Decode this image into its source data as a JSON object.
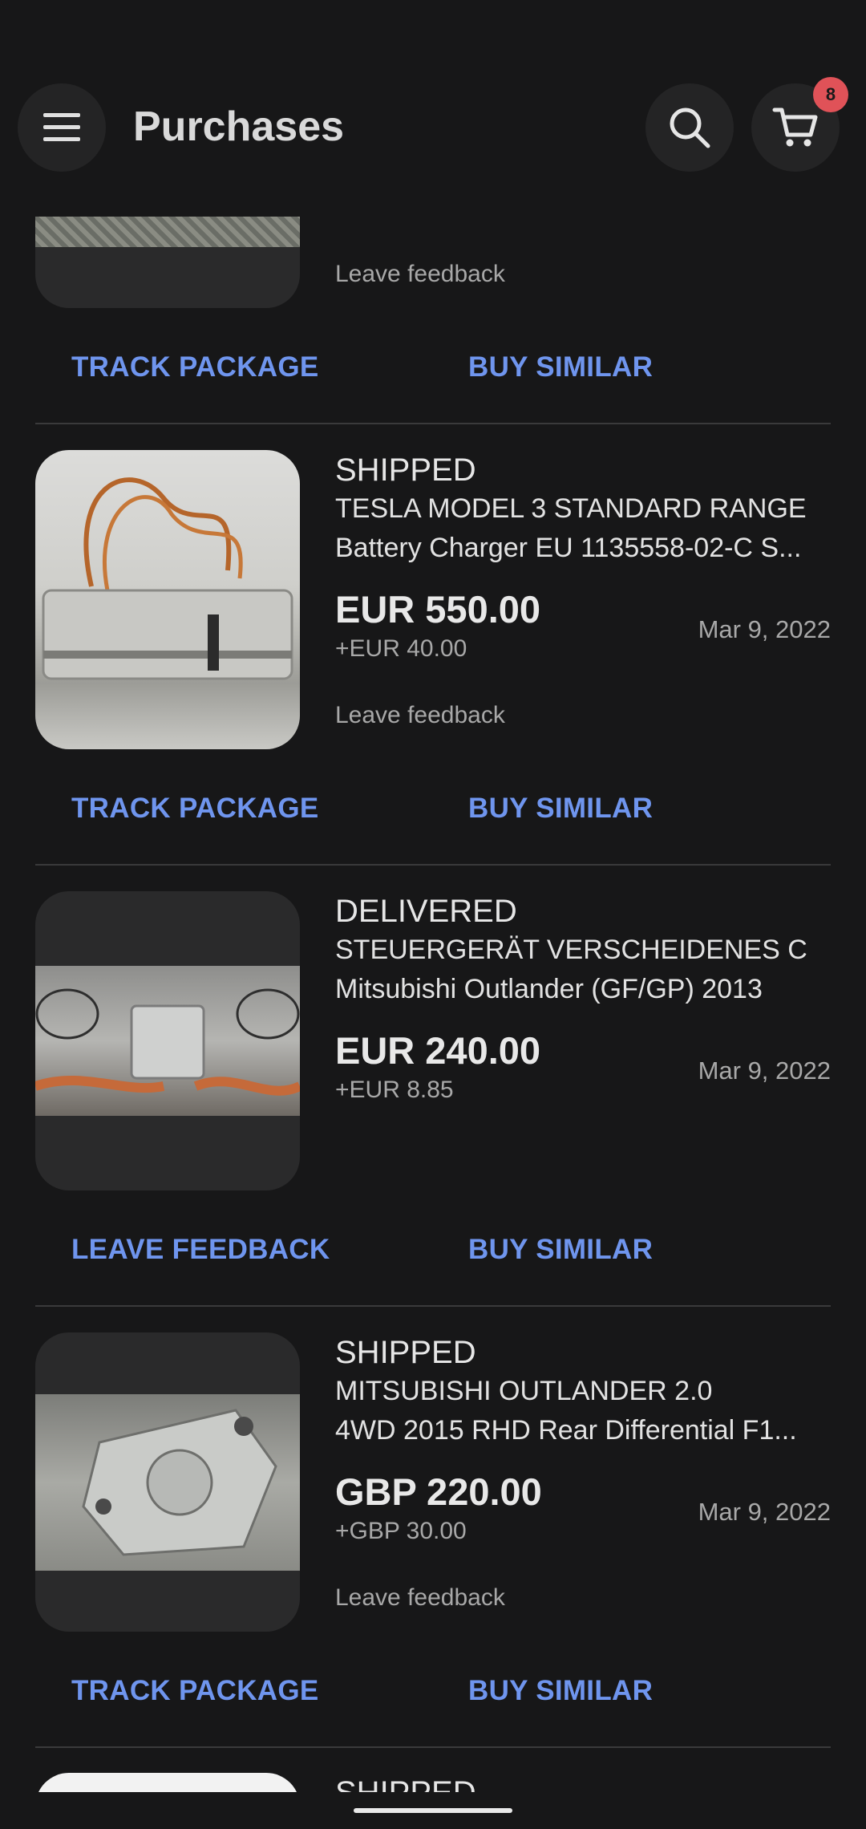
{
  "header": {
    "title": "Purchases",
    "cart_count": "8",
    "icons": [
      "menu-icon",
      "search-icon",
      "cart-icon"
    ]
  },
  "colors": {
    "background": "#171718",
    "action_link": "#6f95ee",
    "badge": "#e05258"
  },
  "top_partial": {
    "feedback": "Leave feedback",
    "actions": [
      "TRACK PACKAGE",
      "BUY SIMILAR"
    ]
  },
  "items": [
    {
      "status": "SHIPPED",
      "title_line1": "TESLA MODEL 3 STANDARD RANGE",
      "title_line2": "Battery Charger EU 1135558-02-C S...",
      "price": "EUR 550.00",
      "shipping": "+EUR 40.00",
      "date": "Mar 9, 2022",
      "feedback": "Leave feedback",
      "actions": [
        "TRACK PACKAGE",
        "BUY SIMILAR"
      ]
    },
    {
      "status": "DELIVERED",
      "title_line1": "STEUERGERÄT VERSCHEIDENES C",
      "title_line2": "Mitsubishi Outlander (GF/GP) 2013",
      "price": "EUR 240.00",
      "shipping": "+EUR 8.85",
      "date": "Mar 9, 2022",
      "actions": [
        "LEAVE FEEDBACK",
        "BUY SIMILAR"
      ]
    },
    {
      "status": "SHIPPED",
      "title_line1": "MITSUBISHI OUTLANDER 2.0",
      "title_line2": "4WD 2015 RHD Rear Differential F1...",
      "price": "GBP 220.00",
      "shipping": "+GBP 30.00",
      "date": "Mar 9, 2022",
      "feedback": "Leave feedback",
      "actions": [
        "TRACK PACKAGE",
        "BUY SIMILAR"
      ]
    }
  ],
  "bottom_partial": {
    "status": "SHIPPED"
  }
}
